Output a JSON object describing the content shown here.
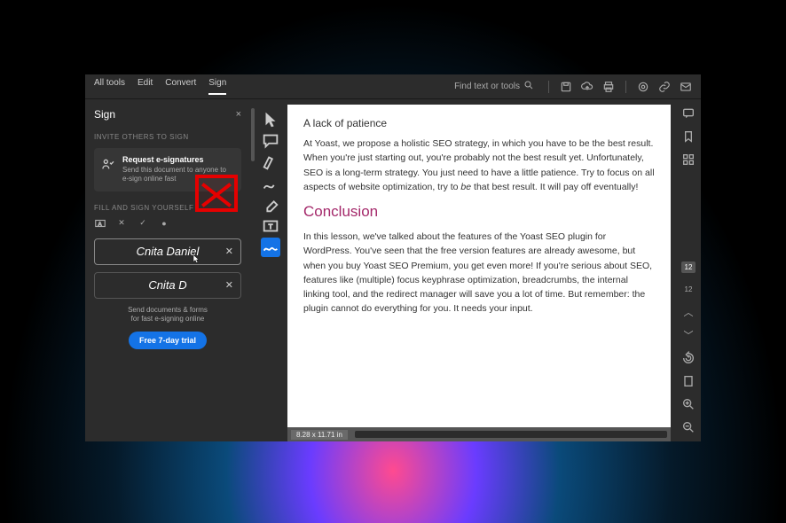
{
  "topbar": {
    "menu": [
      "All tools",
      "Edit",
      "Convert",
      "Sign"
    ],
    "active_menu": 3,
    "search_placeholder": "Find text or tools"
  },
  "sidebar": {
    "title": "Sign",
    "invite_label": "INVITE OTHERS TO SIGN",
    "request": {
      "title": "Request e-signatures",
      "desc": "Send this document to anyone to e-sign online fast"
    },
    "fill_label": "FILL AND SIGN YOURSELF",
    "signatures": [
      {
        "name": "Cnita Daniel",
        "active": true
      },
      {
        "name": "Cnita D",
        "active": false
      }
    ],
    "footer_text": "Send documents & forms\nfor fast e-signing online",
    "trial_button": "Free 7-day trial"
  },
  "document": {
    "heading1": "A lack of patience",
    "para1": "At Yoast, we propose a holistic SEO strategy, in which you have to be the best result. When you're just starting out, you're probably not the best result yet. Unfortunately, SEO is a long-term strategy. You just need to have a little patience. Try to focus on all aspects of website optimization, try to ",
    "para1_em": "be",
    "para1_tail": " that best result. It will pay off eventually!",
    "heading2": "Conclusion",
    "para2": "In this lesson, we've talked about the features of the Yoast SEO plugin for WordPress. You've seen that the free version features are already awesome, but when you buy Yoast SEO Premium, you get even more! If you're serious about SEO, features like (multiple) focus keyphrase optimization, breadcrumbs, the internal linking tool, and the redirect manager will save you a lot of time. But remember: the plugin cannot do everything for you. It needs your input."
  },
  "statusbar": {
    "dimensions": "8.28 x 11.71 in"
  },
  "rightbar": {
    "page_number": "12",
    "total": "12"
  }
}
